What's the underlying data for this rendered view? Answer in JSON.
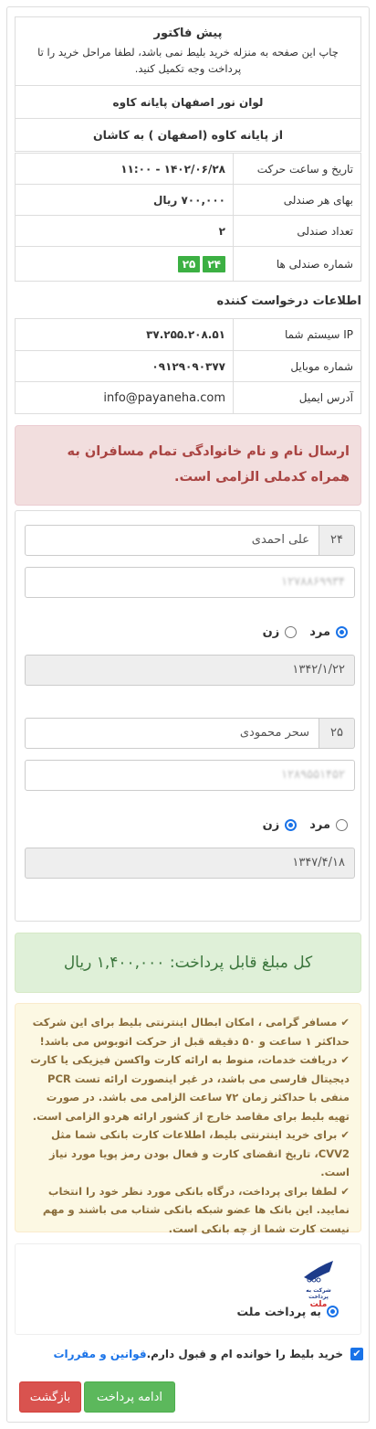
{
  "invoice": {
    "title": "پیش فاکتور",
    "desc": "چاپ این صفحه به منزله خرید بلیط نمی باشد، لطفا مراحل خرید را تا پرداخت وجه تکمیل کنید."
  },
  "trip": {
    "company": "لوان نور اصفهان پایانه کاوه",
    "route": "از پایانه کاوه (اصفهان ) به کاشان",
    "rows": [
      {
        "label": "تاریخ و ساعت حرکت",
        "value": "۱۴۰۲/۰۶/۲۸ - ۱۱:۰۰"
      },
      {
        "label": "بهای هر صندلی",
        "value": "۷۰۰,۰۰۰ ریال"
      },
      {
        "label": "تعداد صندلی",
        "value": "۲"
      }
    ],
    "seats_label": "شماره صندلی ها",
    "seats": [
      "۲۴",
      "۲۵"
    ]
  },
  "requester": {
    "title": "اطلاعات درخواست کننده",
    "rows": [
      {
        "label": "IP سیستم شما",
        "value": "۳۷.۲۵۵.۲۰۸.۵۱"
      },
      {
        "label": "شماره موبایل",
        "value": "۰۹۱۲۹۰۹۰۳۷۷"
      },
      {
        "label": "آدرس ایمیل",
        "value": "info@payaneha.com"
      }
    ]
  },
  "alert_required": "ارسال نام و نام خانوادگی تمام مسافران به همراه کدملی الزامی است.",
  "passengers": [
    {
      "seat": "۲۴",
      "name": "علی احمدی",
      "national_code": "۱۲۷۸۸۶۹۹۳۴",
      "gender_male": "مرد",
      "gender_female": "زن",
      "selected": "male",
      "birth": "۱۳۴۲/۱/۲۲"
    },
    {
      "seat": "۲۵",
      "name": "سحر محمودی",
      "national_code": "۱۲۸۹۵۵۱۴۵۲",
      "gender_male": "مرد",
      "gender_female": "زن",
      "selected": "female",
      "birth": "۱۳۴۷/۴/۱۸"
    }
  ],
  "total": "کل مبلغ قابل پرداخت: ۱,۴۰۰,۰۰۰ ریال",
  "notices": [
    "مسافر گرامی ، امکان ابطال اینترنتی بلیط برای این شرکت حداکثر ۱ ساعت و ۵۰ دقیقه قبل از حرکت اتوبوس می باشد!",
    "دریافت خدمات، منوط به ارائه کارت واکسن فیزیکی یا کارت دیجیتال فارسی می باشد، در غیر اینصورت ارائه تست PCR منفی با حداکثر زمان ۷۲ ساعت الزامی می باشد. در صورت تهیه بلیط برای مقاصد خارج از کشور ارائه هردو الزامی است.",
    "برای خرید اینترنتی بلیط، اطلاعات کارت بانکی شما مثل CVV2، تاریخ انقضای کارت و فعال بودن رمز پویا مورد نیاز است.",
    "لطفا برای پرداخت، درگاه بانکی مورد نظر خود را انتخاب نمایید. این بانک ها عضو شبکه بانکی شتاب می باشند و مهم نیست کارت شما از چه بانکی است."
  ],
  "bank": {
    "logo_caption": "شرکت به پرداخت",
    "logo_word": "ملت",
    "option": "به پرداخت ملت"
  },
  "terms": {
    "link": "قوانین و مقررات",
    "text": "خرید بلیط را خوانده ام و قبول دارم."
  },
  "buttons": {
    "continue": "ادامه پرداخت",
    "back": "بازگشت"
  },
  "colors": {
    "seat_badge": "#3cb043",
    "primary": "#1a73e8",
    "danger": "#d9534f",
    "success": "#5cb85c"
  }
}
